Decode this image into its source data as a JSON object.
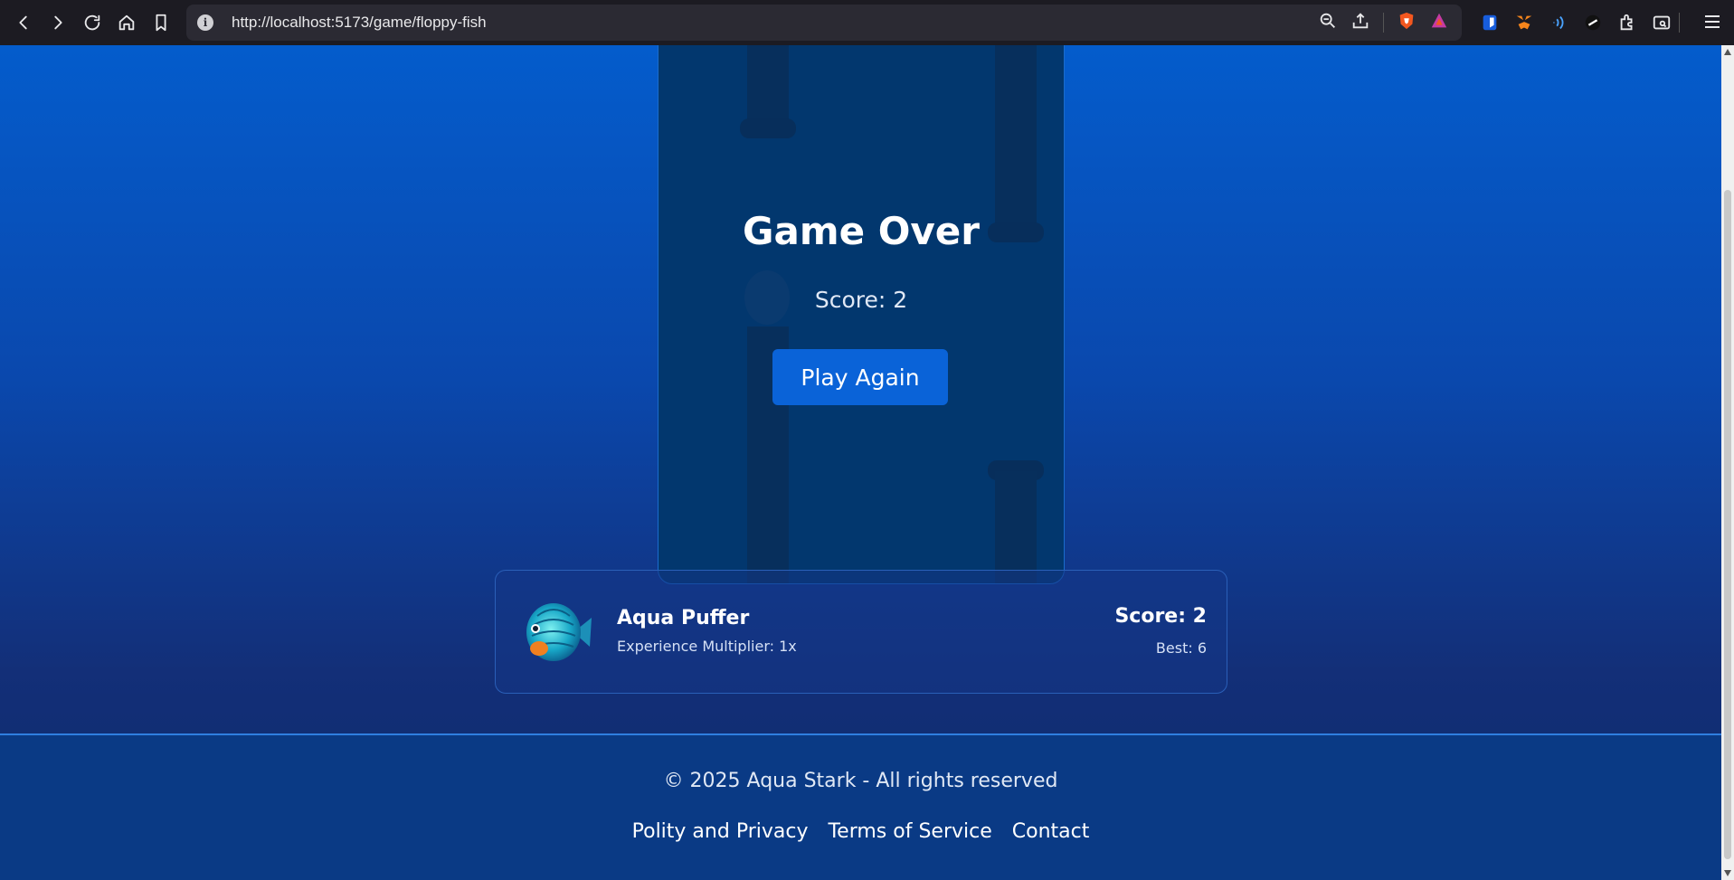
{
  "browser": {
    "url": "http://localhost:5173/game/floppy-fish",
    "info_symbol": "i"
  },
  "game": {
    "title": "Game Over",
    "score_text": "Score: 2",
    "play_again_label": "Play Again"
  },
  "fish_card": {
    "name": "Aqua Puffer",
    "multiplier": "Experience Multiplier: 1x",
    "score": "Score: 2",
    "best": "Best: 6"
  },
  "footer": {
    "copyright": "© 2025 Aqua Stark - All rights reserved",
    "links": [
      {
        "label": "Polity and Privacy"
      },
      {
        "label": "Terms of Service"
      },
      {
        "label": "Contact"
      }
    ]
  },
  "colors": {
    "page_gradient_top": "#045ccc",
    "page_gradient_bottom": "#0c2a6b",
    "accent_button": "#0a63d8",
    "browser_bar": "#1c1b22"
  }
}
